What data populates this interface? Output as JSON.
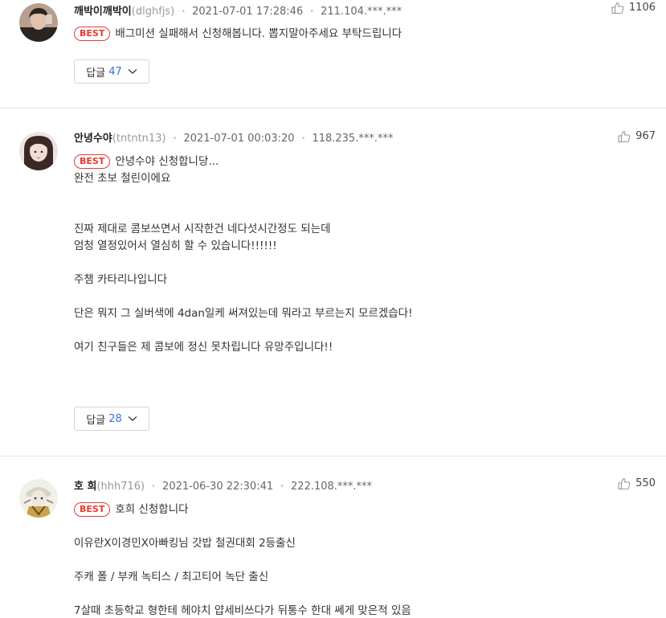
{
  "comments": [
    {
      "nickname": "깨박이깨박이",
      "user_id": "(dlghfjs)",
      "date": "2021-07-01 17:28:46",
      "ip": "211.104.***.***",
      "likes": "1106",
      "badge": "BEST",
      "lines": [
        "배그미션 실패해서 신청해봅니다. 뽑지말아주세요 부탁드립니다"
      ],
      "reply_label": "답글",
      "reply_count": "47"
    },
    {
      "nickname": "안녕수야",
      "user_id": "(tntntn13)",
      "date": "2021-07-01 00:03:20",
      "ip": "118.235.***.***",
      "likes": "967",
      "badge": "BEST",
      "lines": [
        "안녕수야 신청합니당...",
        "완전 초보 철린이에요",
        "",
        "",
        "진짜 제대로 콤보쓰면서 시작한건 네다섯시간정도 되는데",
        "엄청 열정있어서 열심히 할 수 있습니다!!!!!!",
        "",
        "주챔 카타리나입니다",
        "",
        "단은 뭐지 그 실버색에 4dan일케 써져있는데 뭐라고 부르는지 모르겠습다!",
        "",
        "여기 친구들은 제 콤보에 정신 못차립니다 유망주입니다!!"
      ],
      "reply_label": "답글",
      "reply_count": "28"
    },
    {
      "nickname": "호 희",
      "user_id": "(hhh716)",
      "date": "2021-06-30 22:30:41",
      "ip": "222.108.***.***",
      "likes": "550",
      "badge": "BEST",
      "lines": [
        "호희 신청합니다",
        "",
        "이유란X이경민X아빠킹님 갓밥 철권대회 2등출신",
        "",
        "주캐 폴 / 부캐 녹티스 / 최고티어 녹단 출신",
        "",
        "7살때 초등학교 형한테 헤야치 얍세비쓰다가 뒤통수 한대 쎄게 맞은적 있음"
      ]
    }
  ],
  "icons": {
    "like": "thumbs-up-icon",
    "chevron": "chevron-down-icon"
  },
  "colors": {
    "best_badge": "#e53935",
    "reply_count": "#3a6fd8",
    "divider": "#e4e4e4"
  }
}
